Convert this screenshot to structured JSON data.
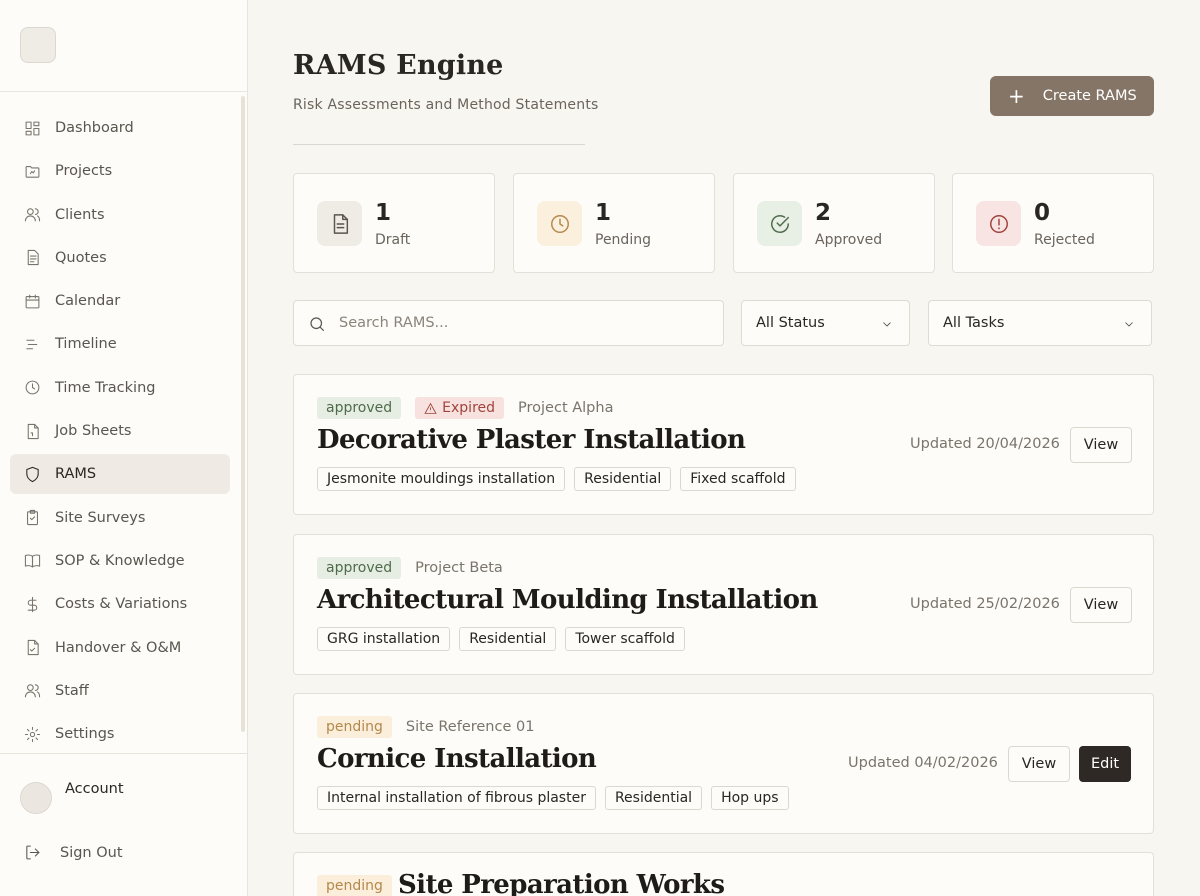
{
  "sidebar": {
    "items": [
      {
        "label": "Dashboard",
        "icon": "dashboard-icon"
      },
      {
        "label": "Projects",
        "icon": "folder-icon"
      },
      {
        "label": "Clients",
        "icon": "users-icon"
      },
      {
        "label": "Quotes",
        "icon": "document-icon"
      },
      {
        "label": "Calendar",
        "icon": "calendar-icon"
      },
      {
        "label": "Timeline",
        "icon": "timeline-icon"
      },
      {
        "label": "Time Tracking",
        "icon": "clock-icon"
      },
      {
        "label": "Job Sheets",
        "icon": "file-icon"
      },
      {
        "label": "RAMS",
        "icon": "shield-icon",
        "active": true
      },
      {
        "label": "Site Surveys",
        "icon": "clipboard-icon"
      },
      {
        "label": "SOP & Knowledge",
        "icon": "book-icon"
      },
      {
        "label": "Costs & Variations",
        "icon": "dollar-icon"
      },
      {
        "label": "Handover & O&M",
        "icon": "file-check-icon"
      },
      {
        "label": "Staff",
        "icon": "users-icon"
      },
      {
        "label": "Settings",
        "icon": "gear-icon"
      }
    ],
    "account_label": "Account",
    "signout_label": "Sign Out"
  },
  "header": {
    "title": "RAMS Engine",
    "subtitle": "Risk Assessments and Method Statements",
    "create_label": "Create RAMS"
  },
  "stats": [
    {
      "value": "1",
      "label": "Draft",
      "icon": "document-icon"
    },
    {
      "value": "1",
      "label": "Pending",
      "icon": "clock-icon"
    },
    {
      "value": "2",
      "label": "Approved",
      "icon": "check-circle-icon"
    },
    {
      "value": "0",
      "label": "Rejected",
      "icon": "alert-circle-icon"
    }
  ],
  "filters": {
    "search_placeholder": "Search RAMS...",
    "status_value": "All Status",
    "task_value": "All Tasks"
  },
  "rams": [
    {
      "status": "approved",
      "expired": "Expired",
      "project": "Project Alpha",
      "title": "Decorative Plaster Installation",
      "tags": [
        "Jesmonite mouldings installation",
        "Residential",
        "Fixed scaffold"
      ],
      "updated": "Updated 20/04/2026",
      "view_label": "View"
    },
    {
      "status": "approved",
      "project": "Project Beta",
      "title": "Architectural Moulding Installation",
      "tags": [
        "GRG installation",
        "Residential",
        "Tower scaffold"
      ],
      "updated": "Updated 25/02/2026",
      "view_label": "View"
    },
    {
      "status": "pending",
      "project": "Site Reference 01",
      "title": "Cornice Installation",
      "tags": [
        "Internal installation of fibrous plaster",
        "Residential",
        "Hop ups"
      ],
      "updated": "Updated 04/02/2026",
      "view_label": "View",
      "edit_label": "Edit"
    },
    {
      "status": "pending",
      "title": "Site Preparation Works"
    }
  ],
  "colors": {
    "accent_button": "#857566",
    "approved_bg": "#e6eee3",
    "pending_bg": "#fbeedb",
    "expired_bg": "#f7e2df"
  }
}
